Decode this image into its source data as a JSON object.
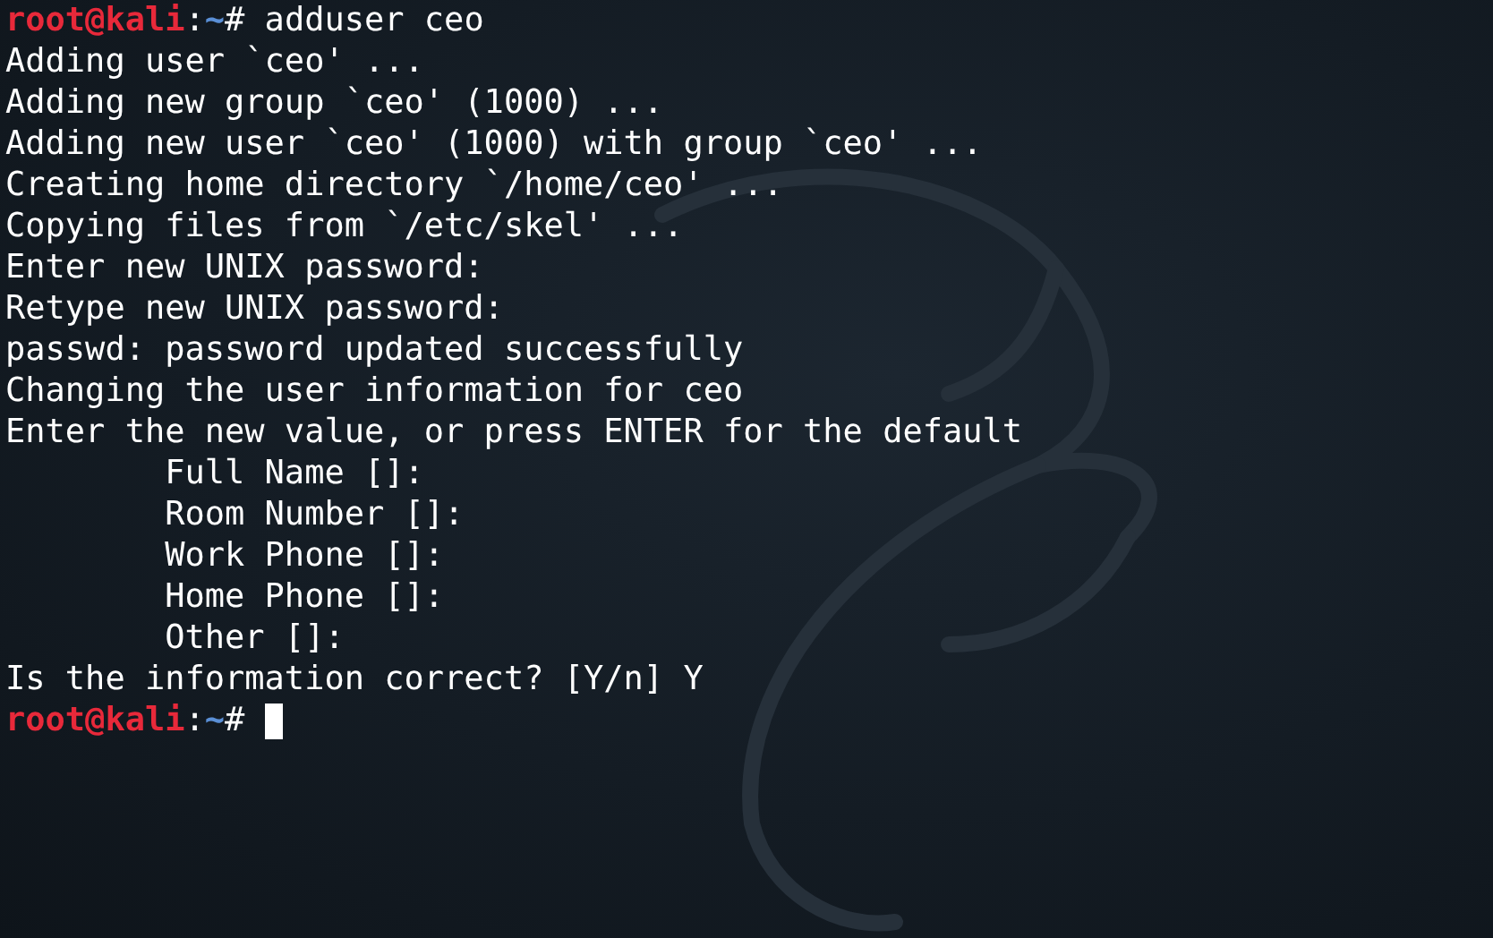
{
  "terminal": {
    "lines": [
      {
        "kind": "prompt",
        "user": "root@kali",
        "separator": ":",
        "path": "~",
        "symbol": "#",
        "command": "adduser ceo",
        "cursor": false
      },
      {
        "kind": "output",
        "text": "Adding user `ceo' ..."
      },
      {
        "kind": "output",
        "text": "Adding new group `ceo' (1000) ..."
      },
      {
        "kind": "output",
        "text": "Adding new user `ceo' (1000) with group `ceo' ..."
      },
      {
        "kind": "output",
        "text": "Creating home directory `/home/ceo' ..."
      },
      {
        "kind": "output",
        "text": "Copying files from `/etc/skel' ..."
      },
      {
        "kind": "output",
        "text": "Enter new UNIX password:"
      },
      {
        "kind": "output",
        "text": "Retype new UNIX password:"
      },
      {
        "kind": "output",
        "text": "passwd: password updated successfully"
      },
      {
        "kind": "output",
        "text": "Changing the user information for ceo"
      },
      {
        "kind": "output",
        "text": "Enter the new value, or press ENTER for the default"
      },
      {
        "kind": "output",
        "text": "        Full Name []:"
      },
      {
        "kind": "output",
        "text": "        Room Number []:"
      },
      {
        "kind": "output",
        "text": "        Work Phone []:"
      },
      {
        "kind": "output",
        "text": "        Home Phone []:"
      },
      {
        "kind": "output",
        "text": "        Other []:"
      },
      {
        "kind": "output",
        "text": "Is the information correct? [Y/n] Y"
      },
      {
        "kind": "prompt",
        "user": "root@kali",
        "separator": ":",
        "path": "~",
        "symbol": "#",
        "cursor": true
      }
    ]
  }
}
